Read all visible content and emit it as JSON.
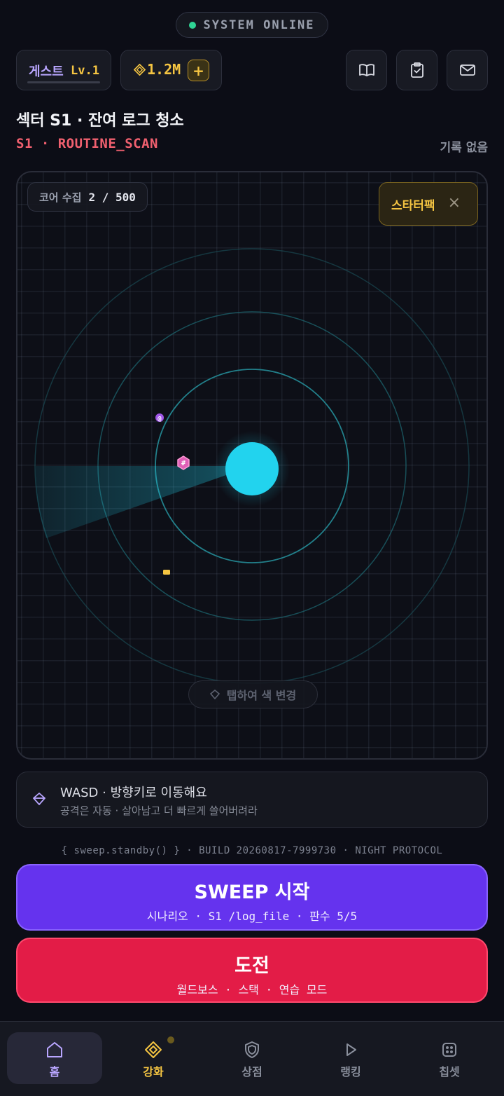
{
  "status": {
    "label": "SYSTEM ONLINE",
    "color": "#2fd494"
  },
  "user": {
    "name": "게스트",
    "level": "Lv.1"
  },
  "currency": {
    "amount": "1.2M",
    "icon": "gem-icon",
    "add_label": "+"
  },
  "header_icons": [
    "book-icon",
    "clipboard-check-icon",
    "mail-icon"
  ],
  "sector": {
    "title": "섹터 S1 · 잔여 로그 청소",
    "subtitle": "S1 · ROUTINE_SCAN",
    "record": "기록 없음"
  },
  "arena": {
    "core_label": "코어 수집",
    "core_value": "2 / 500",
    "starter_label": "스타터팩",
    "close_label": "×",
    "tap_hint": "탭하여 색 변경",
    "glyphs": {
      "pink": "#",
      "purple": "@"
    }
  },
  "hint": {
    "title": "WASD · 방향키로 이동해요",
    "subtitle": "공격은 자동 · 살아남고 더 빠르게 쓸어버려라"
  },
  "build_line": "{ sweep.standby() } · BUILD 20260817-7999730 · NIGHT PROTOCOL",
  "sweep_button": {
    "label": "SWEEP 시작",
    "sub": "시나리오 · S1 /log_file · 판수 5/5"
  },
  "challenge_button": {
    "label": "도전",
    "sub": "월드보스 · 스택 · 연습 모드"
  },
  "nav": [
    {
      "label": "홈",
      "icon": "home-icon",
      "color": "#b9a6ff"
    },
    {
      "label": "강화",
      "icon": "diamond-icon",
      "color": "#f5c542"
    },
    {
      "label": "상점",
      "icon": "shield-icon",
      "color": "#8a8f9c"
    },
    {
      "label": "랭킹",
      "icon": "play-icon",
      "color": "#8a8f9c"
    },
    {
      "label": "칩셋",
      "icon": "chip-icon",
      "color": "#8a8f9c"
    }
  ],
  "colors": {
    "accent_purple": "#6533ee",
    "accent_red": "#e31c47",
    "gold": "#f5c542",
    "player_cyan": "#22d3ee"
  }
}
